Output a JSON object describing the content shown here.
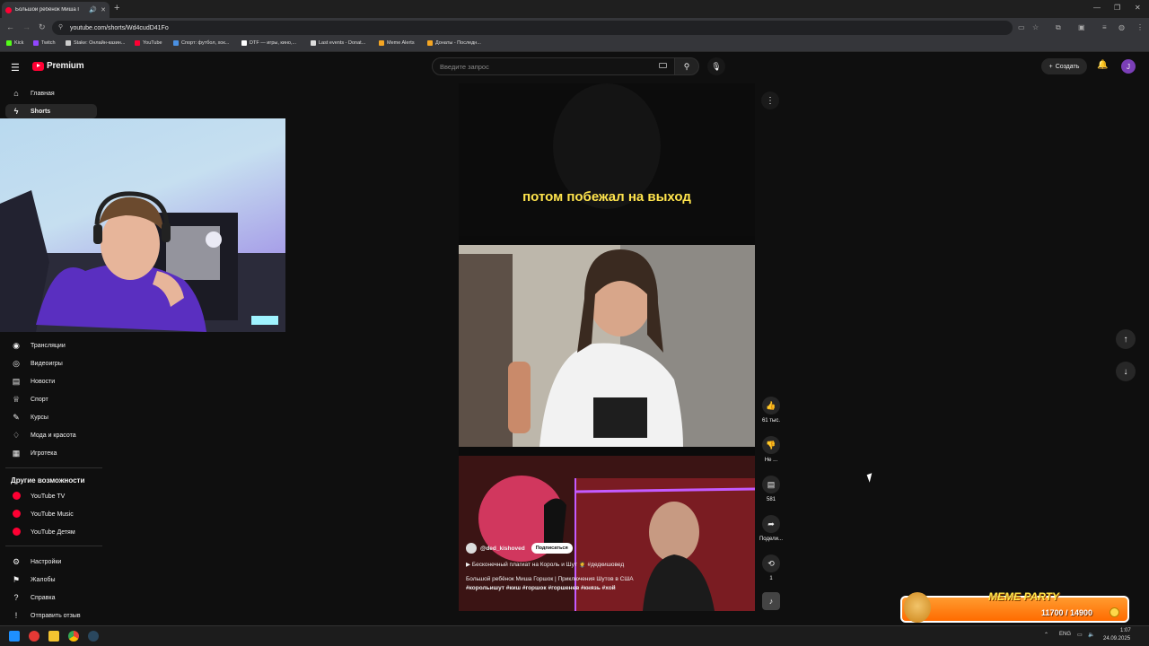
{
  "browser": {
    "tab_title": "Большой ребёнок Миша Г",
    "url": "youtube.com/shorts/Wd4cudD41Fo",
    "bookmarks": [
      {
        "label": "Kick",
        "color": "#53fc18"
      },
      {
        "label": "Twitch",
        "color": "#9146ff"
      },
      {
        "label": "Stake: Онлайн-казин...",
        "color": "#cccccc"
      },
      {
        "label": "YouTube",
        "color": "#ff0033"
      },
      {
        "label": "Спорт: футбол, хок...",
        "color": "#4a90e2"
      },
      {
        "label": "DTF — игры, кино,...",
        "color": "#ffffff"
      },
      {
        "label": "Last events - Donat...",
        "color": "#dddddd"
      },
      {
        "label": "Meme Alerts",
        "color": "#f5a623"
      },
      {
        "label": "Донаты - Последн...",
        "color": "#f5a623"
      }
    ]
  },
  "header": {
    "logo_text": "Premium",
    "search_placeholder": "Введите запрос",
    "create_label": "Создать",
    "avatar_letter": "J"
  },
  "sidebar": {
    "top": [
      {
        "label": "Главная",
        "icon": "home-icon",
        "glyph": "⌂"
      },
      {
        "label": "Shorts",
        "icon": "shorts-icon",
        "glyph": "ϟ"
      }
    ],
    "explore": [
      {
        "label": "Трансляции",
        "icon": "live-icon",
        "glyph": "◉"
      },
      {
        "label": "Видеоигры",
        "icon": "gamepad-icon",
        "glyph": "◎"
      },
      {
        "label": "Новости",
        "icon": "news-icon",
        "glyph": "▤"
      },
      {
        "label": "Спорт",
        "icon": "trophy-icon",
        "glyph": "♕"
      },
      {
        "label": "Курсы",
        "icon": "courses-icon",
        "glyph": "✎"
      },
      {
        "label": "Мода и красота",
        "icon": "fashion-icon",
        "glyph": "♢"
      },
      {
        "label": "Игротека",
        "icon": "playables-icon",
        "glyph": "▦"
      }
    ],
    "more_heading": "Другие возможности",
    "more": [
      {
        "label": "YouTube TV",
        "icon": "youtube-tv-icon"
      },
      {
        "label": "YouTube Music",
        "icon": "youtube-music-icon"
      },
      {
        "label": "YouTube Детям",
        "icon": "youtube-kids-icon"
      }
    ],
    "bottom": [
      {
        "label": "Настройки",
        "icon": "gear-icon",
        "glyph": "⚙"
      },
      {
        "label": "Жалобы",
        "icon": "flag-icon",
        "glyph": "⚑"
      },
      {
        "label": "Справка",
        "icon": "help-icon",
        "glyph": "?"
      },
      {
        "label": "Отправить отзыв",
        "icon": "feedback-icon",
        "glyph": "!"
      }
    ]
  },
  "short": {
    "caption": "потом побежал на выход",
    "channel": "@ded_kishoved",
    "subscribe_label": "Подписаться",
    "playlist": "Бесконечный плагиат на Король и Шут 🤵 #дедкишовед",
    "title": "Большой ребёнок Миша Горшок | Приключения Шутов в США",
    "tags": "#корольишут #киш #горшок #горшенев #князь #хой"
  },
  "actions": {
    "likes": "61 тыс.",
    "dislike": "Не ...",
    "comments": "581",
    "share": "Подели...",
    "remix": "1"
  },
  "widget": {
    "title": "MEME PARTY",
    "count": "11700 / 14900"
  },
  "taskbar": {
    "lang": "ENG",
    "time": "1:07",
    "date": "24.09.2025"
  }
}
